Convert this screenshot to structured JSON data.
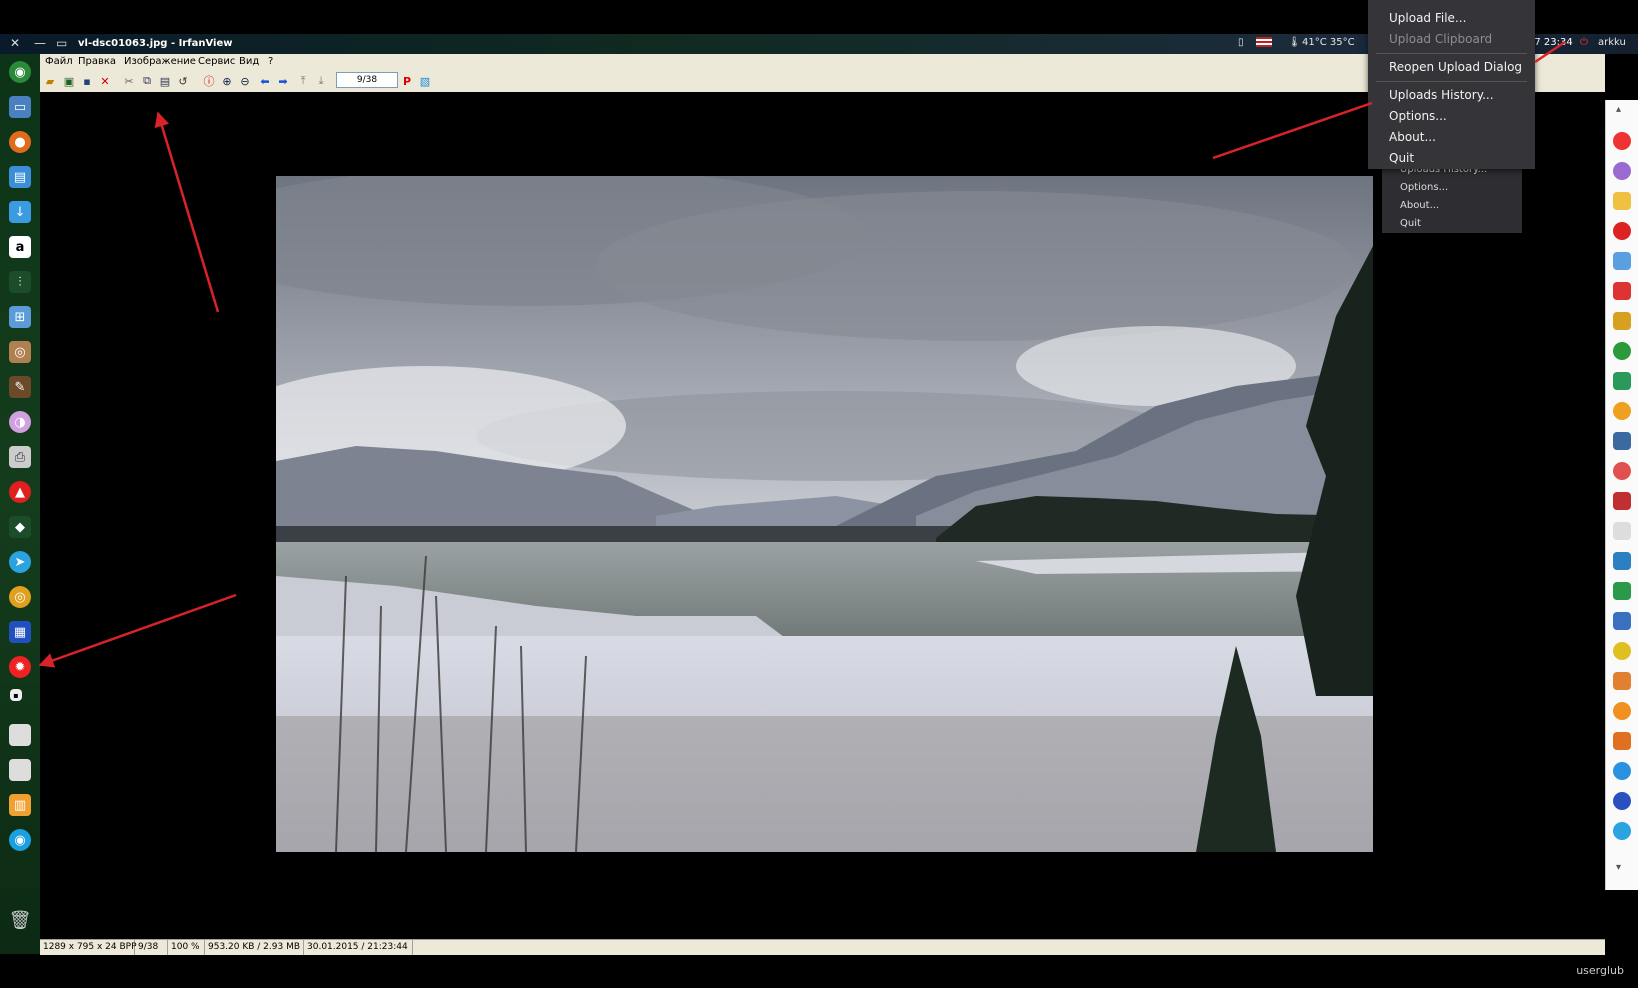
{
  "window": {
    "title": "vl-dsc01063.jpg - IrfanView",
    "close_glyph": "✕",
    "min_glyph": "—",
    "max_glyph": "▭"
  },
  "tray": {
    "temperature": "41°C 35°C",
    "time": "17 23:34",
    "user": "arkku"
  },
  "menubar": {
    "items": [
      "Файл",
      "Правка",
      "Изображение",
      "Сервис",
      "Вид",
      "?"
    ]
  },
  "toolbar": {
    "page_counter": "9/38"
  },
  "statusbar": {
    "cells": [
      "1289 x 795 x 24 BPP",
      "9/38",
      "100 %",
      "953.20 KB / 2.93 MB",
      "30.01.2015 / 21:23:44"
    ]
  },
  "popup_menu": {
    "items": [
      {
        "label": "Upload File...",
        "disabled": false
      },
      {
        "label": "Upload Clipboard",
        "disabled": true
      },
      {
        "label": "Reopen Upload Dialog",
        "disabled": false
      },
      {
        "label": "Uploads History...",
        "disabled": false
      },
      {
        "label": "Options...",
        "disabled": false
      },
      {
        "label": "About...",
        "disabled": false
      },
      {
        "label": "Quit",
        "disabled": false
      }
    ]
  },
  "shadow_menu": {
    "items": [
      "Uploads History...",
      "Options...",
      "About...",
      "Quit"
    ]
  },
  "watermark": "userglub",
  "colors": {
    "arrow": "#d9232a",
    "menu_bg": "#353539",
    "panel_green": "#143d1c"
  }
}
